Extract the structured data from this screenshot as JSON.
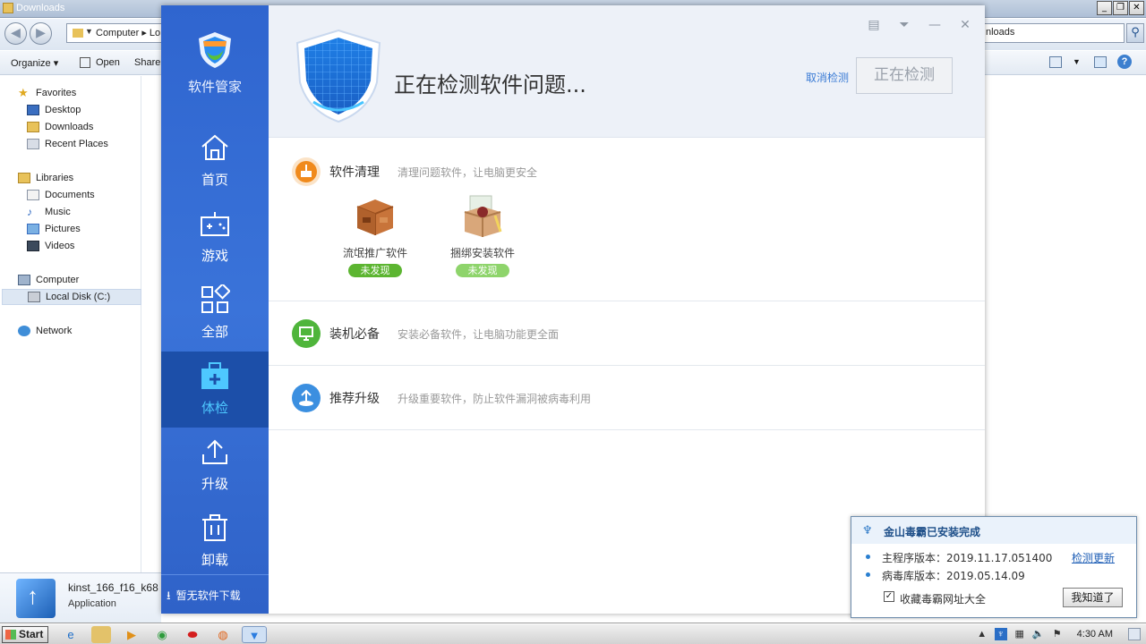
{
  "explorer": {
    "title": "Downloads",
    "address": "Computer ▸ Lo",
    "search": "nloads",
    "toolbar": {
      "organize": "Organize",
      "open": "Open",
      "share": "Share"
    },
    "favorites_header": "Favorites",
    "favorites": [
      "Desktop",
      "Downloads",
      "Recent Places"
    ],
    "libraries_header": "Libraries",
    "libraries": [
      "Documents",
      "Music",
      "Pictures",
      "Videos"
    ],
    "computer": "Computer",
    "local_disk": "Local Disk (C:)",
    "network": "Network",
    "details_name": "kinst_166_f16_k68",
    "details_type": "Application"
  },
  "app": {
    "brand": "软件管家",
    "nav": [
      {
        "label": "首页",
        "icon": "home-icon"
      },
      {
        "label": "游戏",
        "icon": "gamepad-icon"
      },
      {
        "label": "全部",
        "icon": "apps-grid-icon"
      },
      {
        "label": "体检",
        "icon": "medical-kit-icon"
      },
      {
        "label": "升级",
        "icon": "upload-icon"
      },
      {
        "label": "卸载",
        "icon": "trash-icon"
      }
    ],
    "nav_bottom": "暂无软件下载",
    "header": {
      "title": "正在检测软件问题...",
      "cancel": "取消检测",
      "scan_button": "正在检测"
    },
    "sections": [
      {
        "title": "软件清理",
        "desc": "清理问题软件，让电脑更安全",
        "color": "#f08a1c"
      },
      {
        "title": "装机必备",
        "desc": "安装必备软件，让电脑功能更全面",
        "color": "#4fb53b"
      },
      {
        "title": "推荐升级",
        "desc": "升级重要软件，防止软件漏洞被病毒利用",
        "color": "#3b8fe0"
      }
    ],
    "packages": [
      {
        "label": "流氓推广软件",
        "status": "未发现",
        "badge_color": "#5cb531"
      },
      {
        "label": "捆绑安装软件",
        "status": "未发现",
        "badge_color": "#8ed46b"
      }
    ]
  },
  "popup": {
    "title": "金山毒霸已安装完成",
    "program_version_label": "主程序版本：",
    "program_version": "2019.11.17.051400",
    "virus_db_label": "病毒库版本：",
    "virus_db": "2019.05.14.09",
    "check_update": "检测更新",
    "checkbox_label": "收藏毒霸网址大全",
    "ok_button": "我知道了"
  },
  "taskbar": {
    "start": "Start",
    "clock": "4:30 AM"
  }
}
